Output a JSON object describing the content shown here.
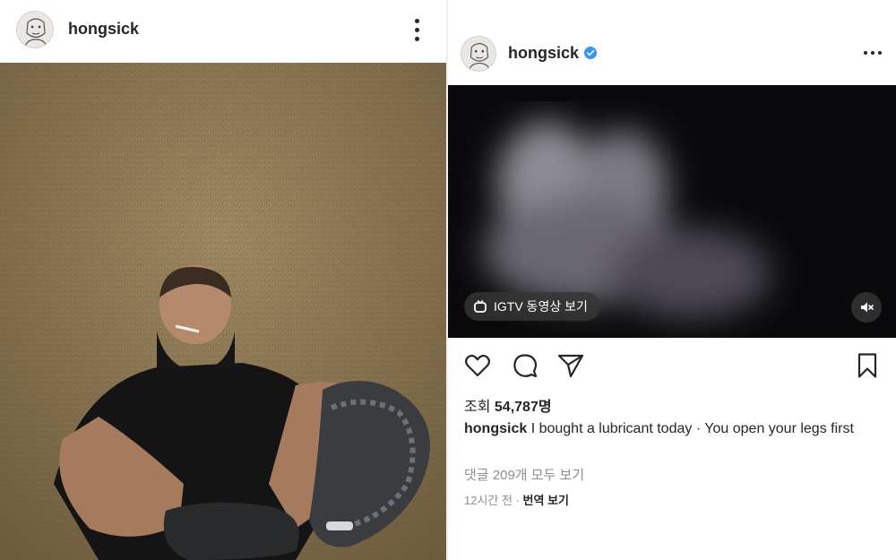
{
  "left_post": {
    "username": "hongsick",
    "more_icon": "vertical-more-icon"
  },
  "right_post": {
    "username": "hongsick",
    "verified_icon": "verified-badge-icon",
    "more_icon": "horizontal-more-icon",
    "igtv_label": "IGTV 동영상 보기",
    "mute_icon": "speaker-muted-icon",
    "actions": [
      "heart-icon",
      "comment-icon",
      "share-icon",
      "bookmark-icon"
    ],
    "views_label": "조회",
    "views_count": "54,787명",
    "caption_username": "hongsick",
    "caption_text": "I bought a lubricant today · You open your legs first",
    "comments_link": "댓글 209개 모두 보기",
    "time_ago": "12시간 전",
    "meta_separator": "·",
    "translate_link": "번역 보기",
    "colors": {
      "verified": "#3897f0",
      "muted_text": "#8e8e8e",
      "text": "#262626"
    }
  }
}
